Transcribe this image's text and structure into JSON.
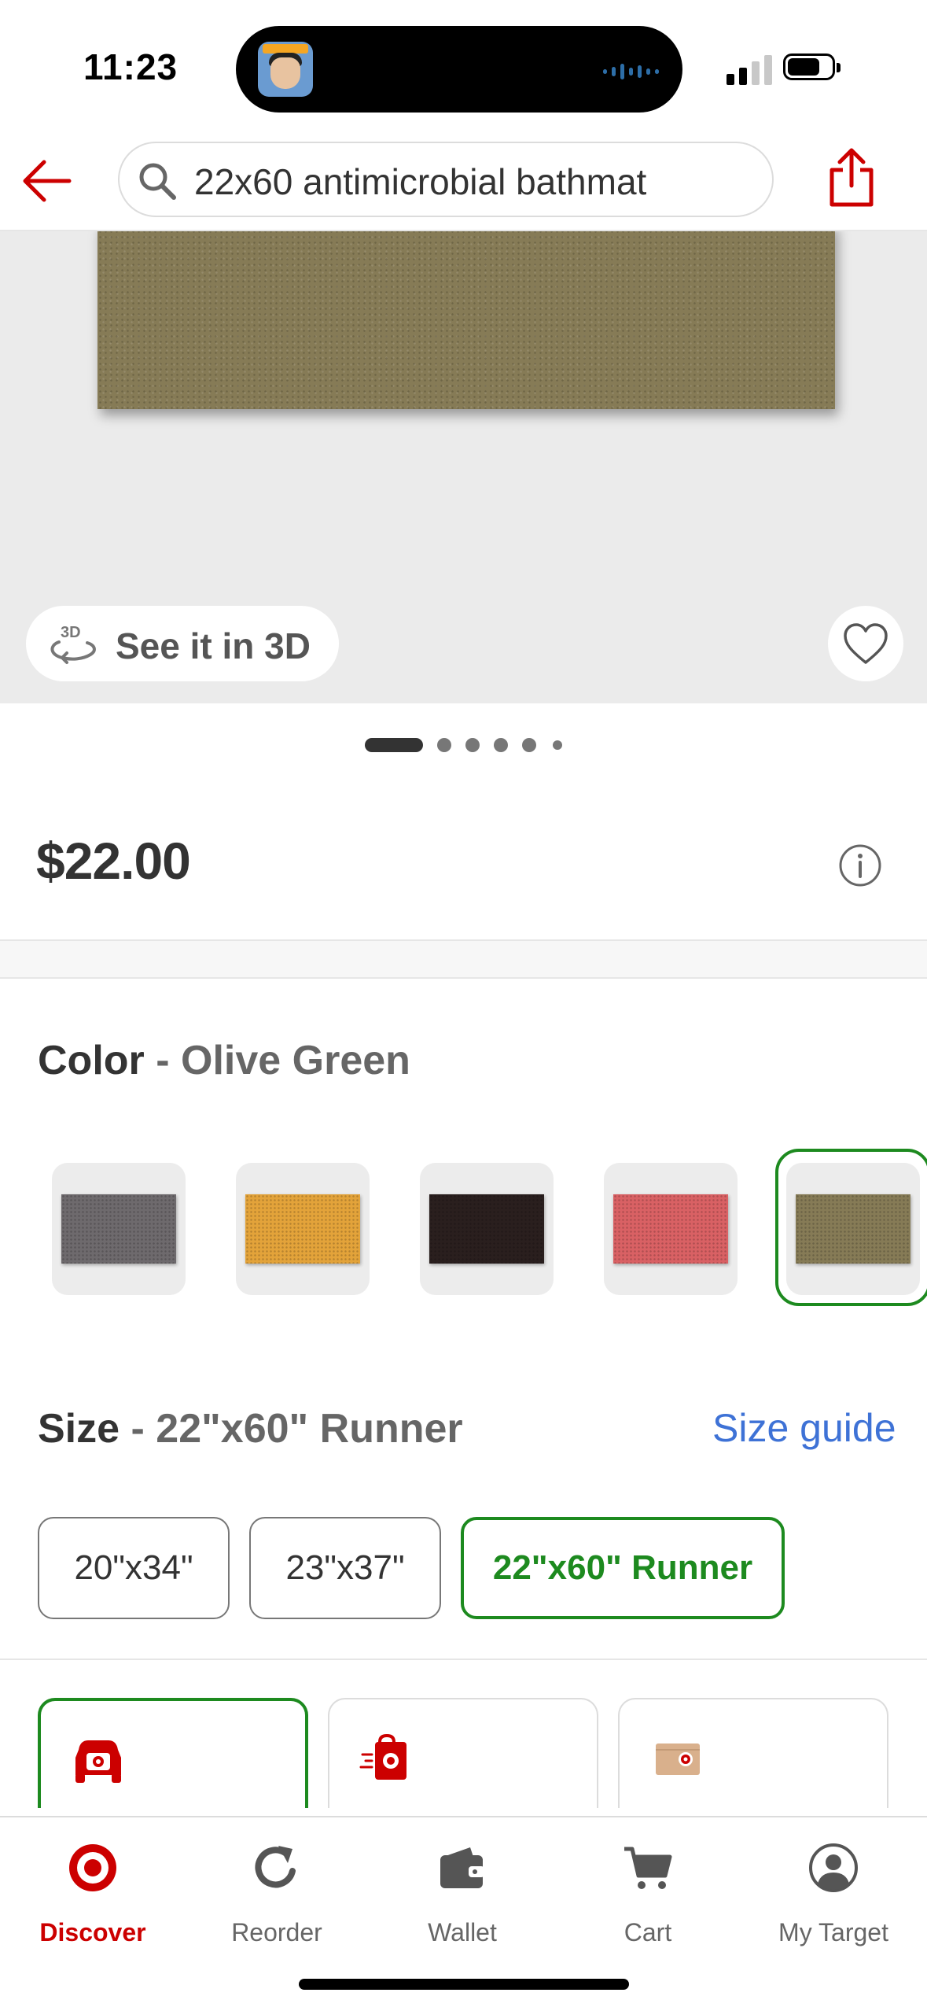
{
  "status_bar": {
    "time": "11:23"
  },
  "search": {
    "query": "22x60 antimicrobial bathmat"
  },
  "product": {
    "see_3d_label": "See it in 3D",
    "image_pages": 6,
    "active_image_page": 1,
    "price": "$22.00"
  },
  "color": {
    "label": "Color",
    "separator": "-",
    "selected": "Olive Green",
    "swatches": [
      {
        "color": "#6e6a6d"
      },
      {
        "color": "#e3a33a"
      },
      {
        "color": "#2a1f1e"
      },
      {
        "color": "#d96164"
      },
      {
        "color": "#867b56",
        "selected": true
      }
    ]
  },
  "size": {
    "label": "Size",
    "separator": "-",
    "selected": "22\"x60\" Runner",
    "guide_label": "Size guide",
    "options": [
      "20\"x34\"",
      "23\"x37\"",
      "22\"x60\" Runner"
    ]
  },
  "tabs": [
    {
      "label": "Discover",
      "icon": "target-logo-icon",
      "active": true
    },
    {
      "label": "Reorder",
      "icon": "reorder-icon"
    },
    {
      "label": "Wallet",
      "icon": "wallet-icon"
    },
    {
      "label": "Cart",
      "icon": "cart-icon"
    },
    {
      "label": "My Target",
      "icon": "account-icon"
    }
  ],
  "colors": {
    "brand_red": "#cc0000",
    "selected_green": "#1d8a1f",
    "link_blue": "#3e72d6"
  }
}
